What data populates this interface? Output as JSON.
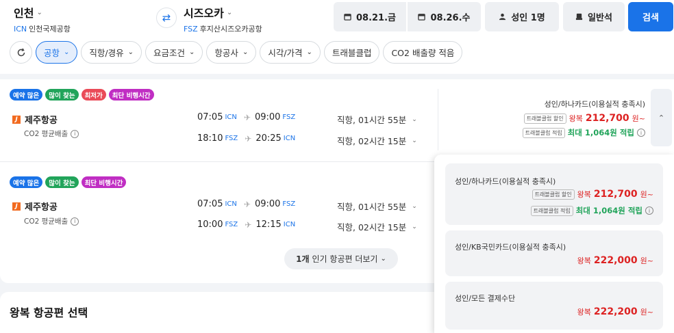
{
  "search": {
    "origin": {
      "city": "인천",
      "code": "ICN",
      "airport": "인천국제공항"
    },
    "destination": {
      "city": "시즈오카",
      "code": "FSZ",
      "airport": "후지산시즈오카공항"
    },
    "depart_date": "08.21.금",
    "return_date": "08.26.수",
    "passengers": "성인 1명",
    "seat_class": "일반석",
    "search_label": "검색"
  },
  "filters": [
    {
      "label": "공항",
      "active": true
    },
    {
      "label": "직항/경유",
      "active": false
    },
    {
      "label": "요금조건",
      "active": false
    },
    {
      "label": "항공사",
      "active": false
    },
    {
      "label": "시각/가격",
      "active": false
    },
    {
      "label": "트래블클럽",
      "active": false
    },
    {
      "label": "CO2 배출량 적음",
      "active": false
    }
  ],
  "flights": [
    {
      "tags": [
        "예약 많은",
        "많이 찾는",
        "최저가",
        "최단 비행시간"
      ],
      "airline": "제주항공",
      "co2": "CO2 평균배출",
      "outbound": {
        "dep_time": "07:05",
        "dep_code": "ICN",
        "arr_time": "09:00",
        "arr_code": "FSZ",
        "duration": "직항, 01시간 55분"
      },
      "inbound": {
        "dep_time": "18:10",
        "dep_code": "FSZ",
        "arr_time": "20:25",
        "arr_code": "ICN",
        "duration": "직항, 02시간 15분"
      },
      "price": {
        "label": "성인/하나카드(이용실적 충족시)",
        "discount_badge": "트래블클럽 할인",
        "round_trip": "왕복",
        "amount": "212,700",
        "suffix": "원~",
        "earn_badge": "트래블클럽 적립",
        "earn": "최대 1,064원 적립"
      }
    },
    {
      "tags": [
        "예약 많은",
        "많이 찾는",
        "최단 비행시간"
      ],
      "airline": "제주항공",
      "co2": "CO2 평균배출",
      "outbound": {
        "dep_time": "07:05",
        "dep_code": "ICN",
        "arr_time": "09:00",
        "arr_code": "FSZ",
        "duration": "직항, 01시간 55분"
      },
      "inbound": {
        "dep_time": "10:00",
        "dep_code": "FSZ",
        "arr_time": "12:15",
        "arr_code": "ICN",
        "duration": "직항, 02시간 15분"
      }
    }
  ],
  "more_button": {
    "count": "1개",
    "label": "인기 항공편 더보기"
  },
  "return_section_title": "왕복 항공편 선택",
  "price_options": [
    {
      "label": "성인/하나카드(이용실적 충족시)",
      "discount_badge": "트래블클럽 할인",
      "round_trip": "왕복",
      "amount": "212,700",
      "suffix": "원~",
      "earn_badge": "트래블클럽 적립",
      "earn": "최대 1,064원 적립"
    },
    {
      "label": "성인/KB국민카드(이용실적 충족시)",
      "round_trip": "왕복",
      "amount": "222,000",
      "suffix": "원~"
    },
    {
      "label": "성인/모든 결제수단",
      "round_trip": "왕복",
      "amount": "222,200",
      "suffix": "원~"
    }
  ],
  "colors": {
    "accent": "#1a73e8",
    "price": "#dd2222",
    "earn": "#21a45a",
    "tag_red": "#ea4b58",
    "tag_purple": "#c02ec3"
  }
}
